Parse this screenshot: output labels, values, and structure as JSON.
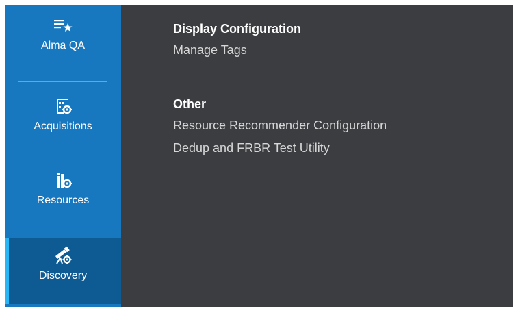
{
  "sidebar": {
    "items": [
      {
        "label": "Alma QA",
        "icon": "list-star-icon"
      },
      {
        "label": "Acquisitions",
        "icon": "acquisitions-gear-icon"
      },
      {
        "label": "Resources",
        "icon": "resources-gear-icon"
      },
      {
        "label": "Discovery",
        "icon": "telescope-gear-icon",
        "active": true
      }
    ]
  },
  "panel": {
    "sections": [
      {
        "title": "Display Configuration",
        "links": [
          "Manage Tags"
        ]
      },
      {
        "title": "Other",
        "links": [
          "Resource Recommender Configuration",
          "Dedup and FRBR Test Utility"
        ]
      }
    ]
  },
  "colors": {
    "sidebar_bg": "#1878bf",
    "active_item_bg": "#0e5a92",
    "active_indicator": "#29b6f6",
    "panel_bg": "#3b3d40",
    "link_text": "#d6d6d6",
    "title_text": "#ffffff"
  }
}
